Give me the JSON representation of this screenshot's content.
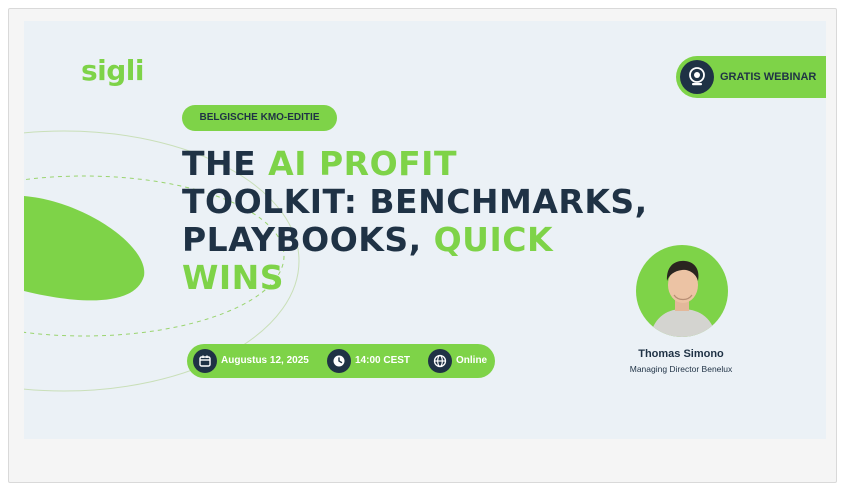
{
  "brand": {
    "logo_text": "sigli",
    "accent_color": "#7ed348",
    "dark_color": "#1f3245"
  },
  "webinar": {
    "label": "GRATIS WEBINAR",
    "icon": "webcam-icon"
  },
  "edition_badge": "BELGISCHE KMO-EDITIE",
  "title": {
    "part1": "THE ",
    "part2": "AI PROFIT",
    "part3": "TOOLKIT: BENCHMARKS,",
    "part4": "PLAYBOOKS, ",
    "part5": "QUICK",
    "part6": "WINS"
  },
  "event": {
    "date": "Augustus 12, 2025",
    "date_icon": "calendar-icon",
    "time": "14:00 CEST",
    "time_icon": "clock-icon",
    "location": "Online",
    "location_icon": "globe-icon"
  },
  "speaker": {
    "name": "Thomas Simono",
    "role": "Managing Director Benelux"
  }
}
